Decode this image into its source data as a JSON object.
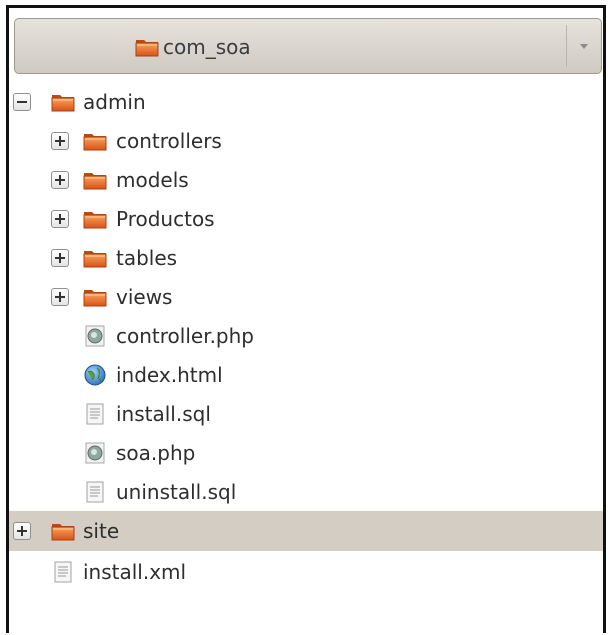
{
  "header": {
    "title": "com_soa",
    "folder_icon": "folder-icon",
    "dropdown_icon": "chevron-down-icon"
  },
  "colors": {
    "folder_orange": "#e8641b",
    "selection": "#d3cdc4",
    "header_bg": "#dcd7cf"
  },
  "tree": {
    "admin": {
      "label": "admin",
      "expanded": true
    },
    "admin_children": [
      {
        "label": "controllers",
        "type": "folder"
      },
      {
        "label": "models",
        "type": "folder"
      },
      {
        "label": "Productos",
        "type": "folder"
      },
      {
        "label": "tables",
        "type": "folder"
      },
      {
        "label": "views",
        "type": "folder"
      },
      {
        "label": "controller.php",
        "type": "php"
      },
      {
        "label": "index.html",
        "type": "html"
      },
      {
        "label": "install.sql",
        "type": "text"
      },
      {
        "label": "soa.php",
        "type": "php"
      },
      {
        "label": "uninstall.sql",
        "type": "text"
      }
    ],
    "site": {
      "label": "site",
      "expanded": false,
      "selected": true
    },
    "install_xml": {
      "label": "install.xml",
      "type": "text"
    }
  }
}
